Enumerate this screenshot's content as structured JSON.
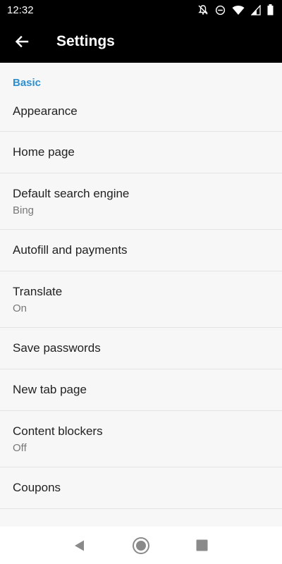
{
  "status_bar": {
    "time": "12:32",
    "icons": [
      "notifications-off-icon",
      "do-not-disturb-icon",
      "wifi-icon",
      "cellular-signal-icon",
      "battery-icon"
    ]
  },
  "app_bar": {
    "title": "Settings",
    "back_icon": "arrow-back-icon"
  },
  "section": {
    "header": "Basic"
  },
  "items": [
    {
      "title": "Appearance",
      "subtitle": ""
    },
    {
      "title": "Home page",
      "subtitle": ""
    },
    {
      "title": "Default search engine",
      "subtitle": "Bing"
    },
    {
      "title": "Autofill and payments",
      "subtitle": ""
    },
    {
      "title": "Translate",
      "subtitle": "On"
    },
    {
      "title": "Save passwords",
      "subtitle": ""
    },
    {
      "title": "New tab page",
      "subtitle": ""
    },
    {
      "title": "Content blockers",
      "subtitle": "Off"
    },
    {
      "title": "Coupons",
      "subtitle": ""
    }
  ],
  "nav_bar": {
    "buttons": [
      "back-triangle-icon",
      "home-circle-icon",
      "recents-square-icon"
    ]
  },
  "colors": {
    "accent": "#2d8fd0",
    "app_bar": "#000000",
    "background": "#f7f7f7"
  }
}
